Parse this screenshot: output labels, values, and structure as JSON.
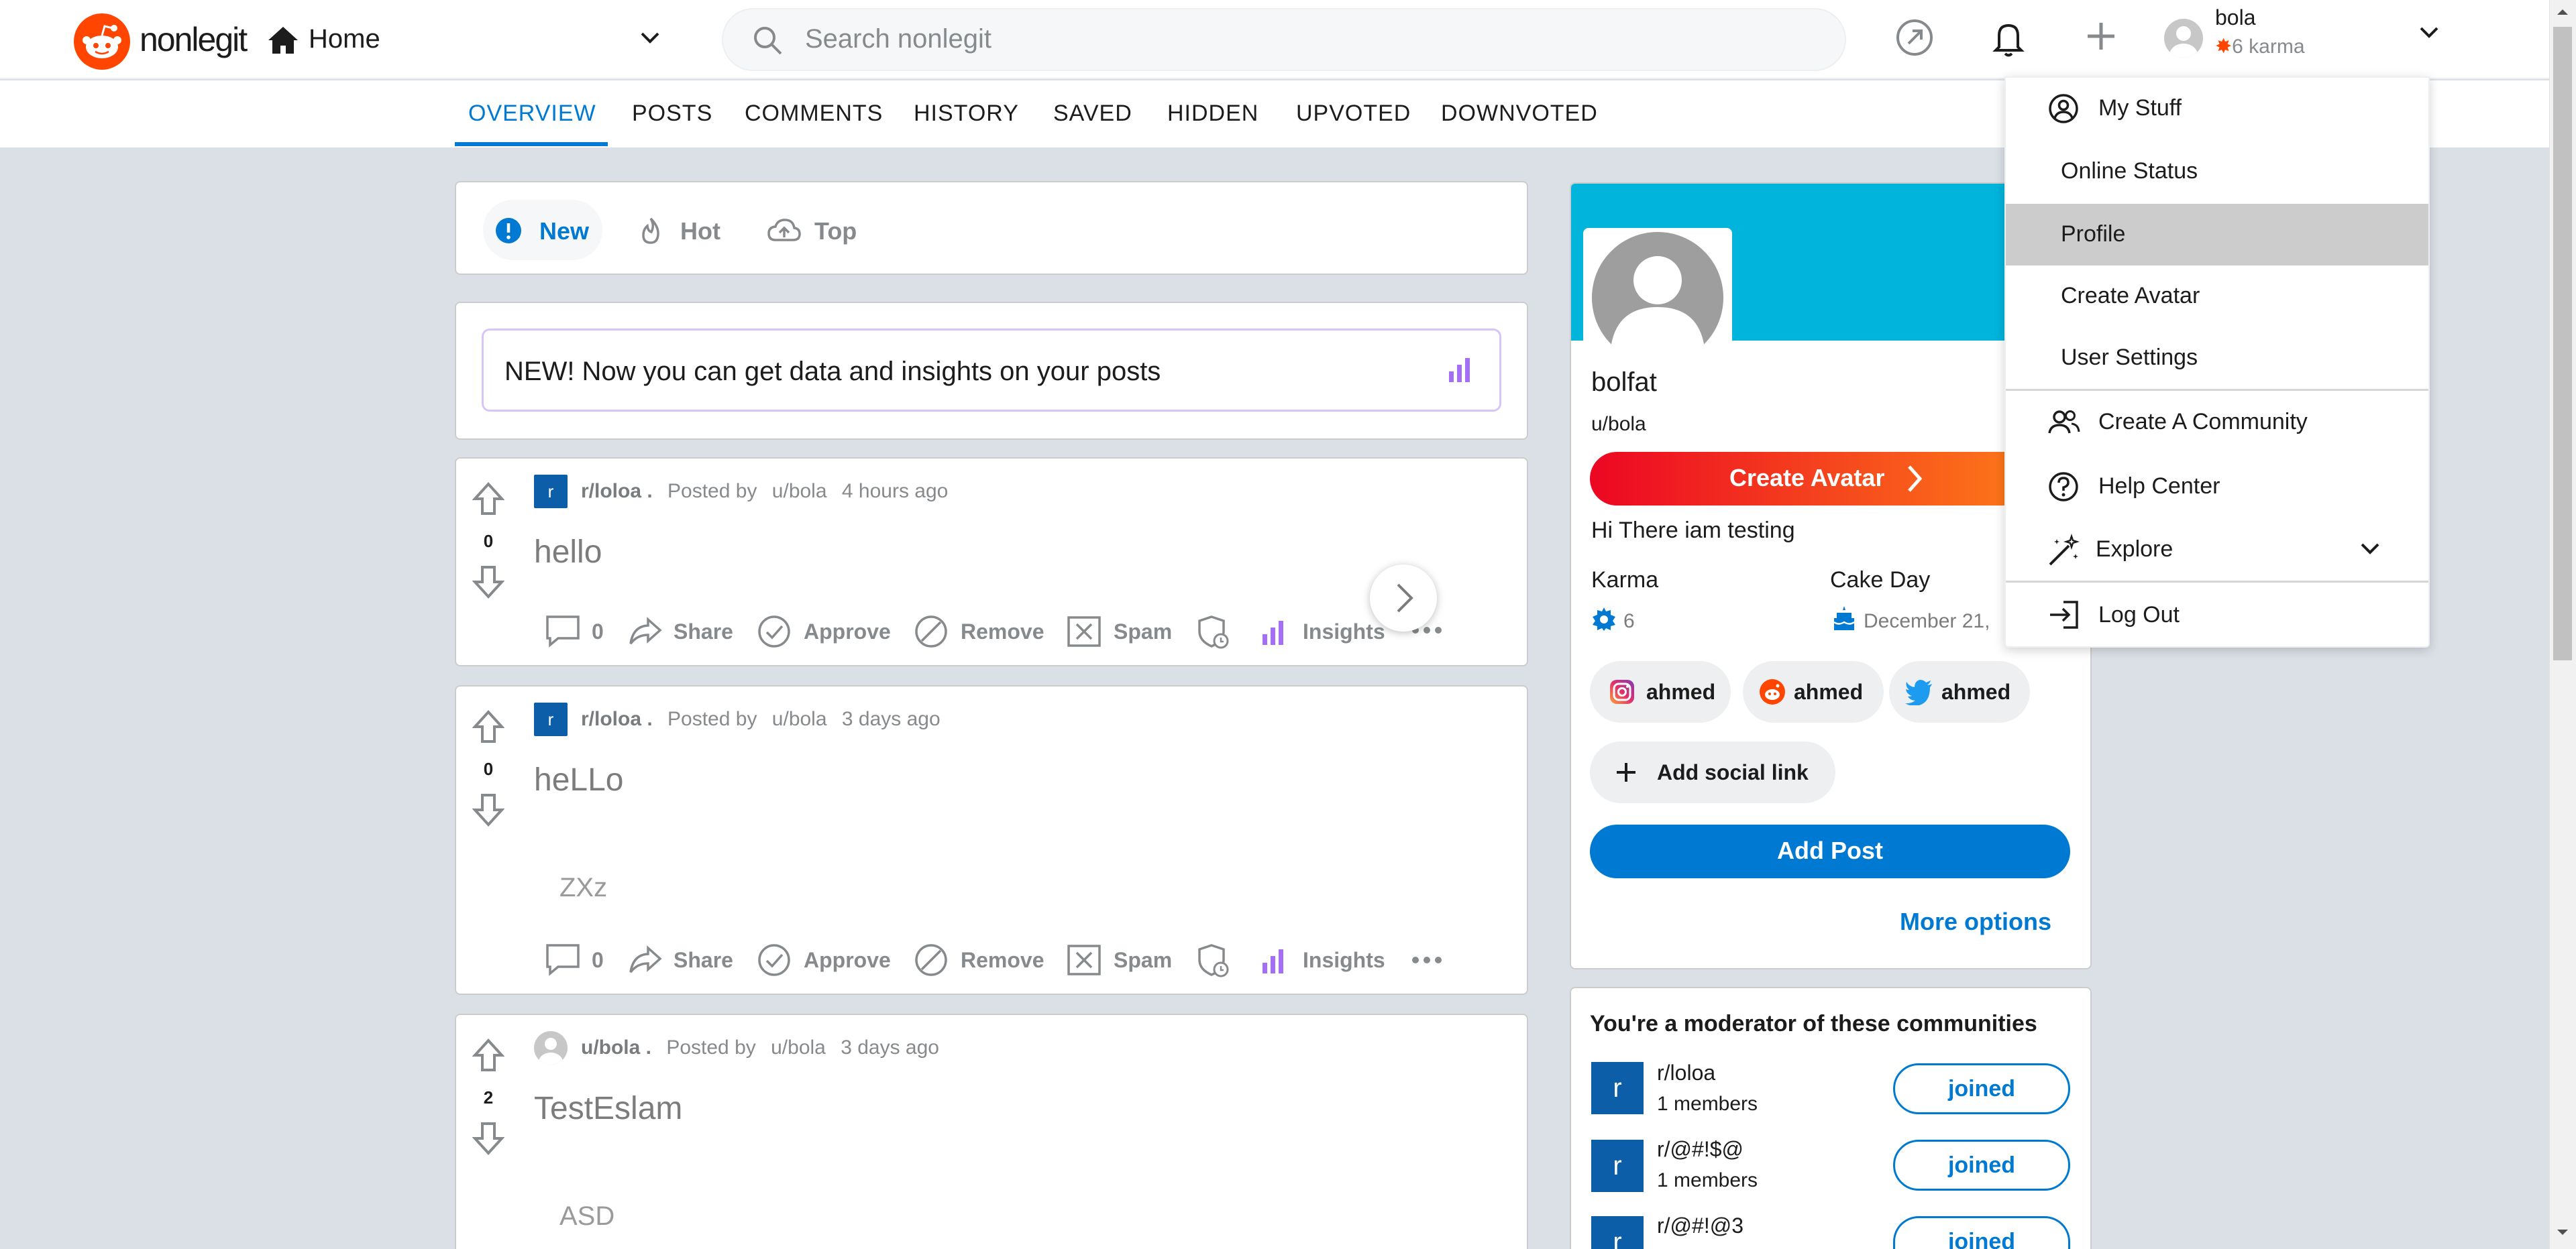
{
  "header": {
    "logo_text": "nonlegit",
    "home_label": "Home",
    "search_placeholder": "Search nonlegit",
    "user": {
      "name": "bola",
      "karma": "6 karma"
    }
  },
  "tabs": [
    "OVERVIEW",
    "POSTS",
    "COMMENTS",
    "HISTORY",
    "SAVED",
    "HIDDEN",
    "UPVOTED",
    "DOWNVOTED"
  ],
  "sort": {
    "new": "New",
    "hot": "Hot",
    "top": "Top"
  },
  "insights_banner": "NEW! Now you can get data and insights on your posts",
  "posts": [
    {
      "sub_icon": "r",
      "community": "r/loloa .",
      "posted_by": "Posted by",
      "author": "u/bola",
      "time": "4 hours ago",
      "votes": "0",
      "title": "hello",
      "body": "",
      "comments": "0"
    },
    {
      "sub_icon": "r",
      "community": "r/loloa .",
      "posted_by": "Posted by",
      "author": "u/bola",
      "time": "3 days ago",
      "votes": "0",
      "title": "heLLo",
      "body": "ZXz",
      "comments": "0"
    },
    {
      "sub_icon": "",
      "community": "u/bola .",
      "posted_by": "Posted by",
      "author": "u/bola",
      "time": "3 days ago",
      "votes": "2",
      "title": "TestEslam",
      "body": "ASD",
      "comments": ""
    }
  ],
  "actions": {
    "share": "Share",
    "approve": "Approve",
    "remove": "Remove",
    "spam": "Spam",
    "insights": "Insights"
  },
  "profile": {
    "display_name": "bolfat",
    "handle": "u/bola",
    "create_avatar": "Create Avatar",
    "bio": "Hi There iam testing",
    "karma_label": "Karma",
    "karma_value": "6",
    "cake_label": "Cake Day",
    "cake_value": "December 21,",
    "socials": [
      {
        "name": "ahmed",
        "icon": "instagram-icon"
      },
      {
        "name": "ahmed",
        "icon": "reddit-icon"
      },
      {
        "name": "ahmed",
        "icon": "twitter-icon"
      }
    ],
    "add_social": "Add social link",
    "add_post": "Add Post",
    "more_options": "More options"
  },
  "moderator": {
    "title": "You're a moderator of these communities",
    "communities": [
      {
        "icon": "r",
        "name": "r/loloa",
        "members": "1 members",
        "button": "joined"
      },
      {
        "icon": "r",
        "name": "r/@#!$@",
        "members": "1 members",
        "button": "joined"
      },
      {
        "icon": "r",
        "name": "r/@#!@3",
        "members": "",
        "button": "joined"
      }
    ]
  },
  "user_menu": {
    "my_stuff": "My Stuff",
    "online_status": "Online Status",
    "profile": "Profile",
    "create_avatar": "Create Avatar",
    "user_settings": "User Settings",
    "create_community": "Create A Community",
    "help_center": "Help Center",
    "explore": "Explore",
    "log_out": "Log Out"
  },
  "colors": {
    "accent": "#0079d3",
    "brand": "#ff4500",
    "banner": "#00b4db",
    "insights": "#a56ef6"
  }
}
